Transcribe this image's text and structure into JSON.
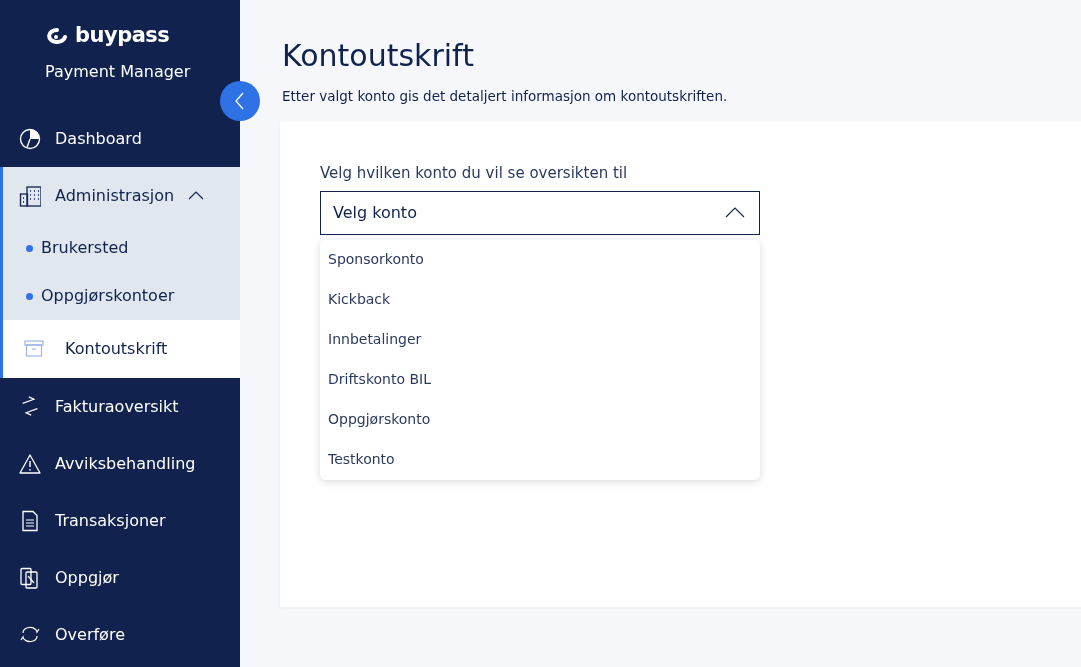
{
  "brand": {
    "logo_text": "buypass",
    "product": "Payment Manager"
  },
  "sidebar": {
    "collapsed": false,
    "items": [
      {
        "kind": "item",
        "label": "Dashboard",
        "selected": false
      },
      {
        "kind": "group",
        "label": "Administrasjon",
        "selected": false,
        "expanded": true,
        "children": [
          {
            "label": "Brukersted",
            "selected": false
          },
          {
            "label": "Oppgjørskontoer",
            "selected": false
          }
        ]
      },
      {
        "kind": "item",
        "label": "Kontoutskrift",
        "selected": true
      },
      {
        "kind": "item",
        "label": "Fakturaoversikt",
        "selected": false
      },
      {
        "kind": "item",
        "label": "Avviksbehandling",
        "selected": false
      },
      {
        "kind": "item",
        "label": "Transaksjoner",
        "selected": false
      },
      {
        "kind": "item",
        "label": "Oppgjør",
        "selected": false
      },
      {
        "kind": "item",
        "label": "Overføre",
        "selected": false
      }
    ]
  },
  "page": {
    "title": "Kontoutskrift",
    "description": "Etter valgt konto gis det detaljert informasjon om kontoutskriften."
  },
  "account_select": {
    "label": "Velg hvilken konto du vil se oversikten til",
    "placeholder": "Velg konto",
    "expanded": true,
    "options": [
      {
        "label": "Sponsorkonto",
        "selected": false
      },
      {
        "label": "Kickback",
        "selected": false
      },
      {
        "label": "Innbetalinger",
        "selected": false
      },
      {
        "label": "Driftskonto BIL",
        "selected": false
      },
      {
        "label": "Oppgjørskonto",
        "selected": false
      },
      {
        "label": "Testkonto",
        "selected": false
      }
    ]
  }
}
